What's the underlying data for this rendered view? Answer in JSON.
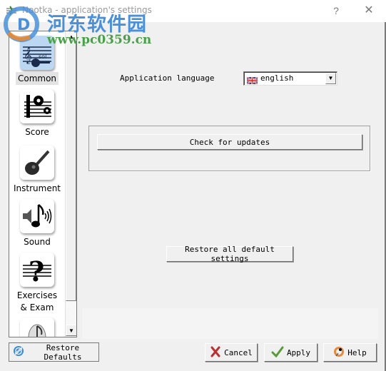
{
  "window": {
    "title": "Nootka - application's settings",
    "help_glyph": "?",
    "close_glyph": "✕"
  },
  "watermark": {
    "site_name": "河东软件园",
    "url": "www.pc0359.cn"
  },
  "sidebar": {
    "items": [
      {
        "label": "Common",
        "icon": "common-settings-icon",
        "active": true
      },
      {
        "label": "Score",
        "icon": "score-settings-icon",
        "active": false
      },
      {
        "label": "Instrument",
        "icon": "guitar-icon",
        "active": false
      },
      {
        "label": "Sound",
        "icon": "sound-icon",
        "active": false
      },
      {
        "label": "Exercises\n& Exam",
        "label_line1": "Exercises",
        "label_line2": "& Exam",
        "icon": "question-staff-icon",
        "active": false
      },
      {
        "label": "",
        "icon": "note-icon",
        "active": false
      }
    ],
    "scroll_up_glyph": "▲",
    "scroll_down_glyph": "▼"
  },
  "common": {
    "language_label": "Application language",
    "language_value": "english",
    "language_flag": "uk-flag-icon",
    "dropdown_glyph": "▼",
    "check_updates_label": "Check for updates",
    "restore_all_label": "Restore all default settings"
  },
  "footer": {
    "restore_defaults_label": "Restore Defaults",
    "cancel_label": "Cancel",
    "apply_label": "Apply",
    "help_label": "Help"
  },
  "colors": {
    "active_nav_bg": "#bcd7f2",
    "watermark_blue": "#4a90d9",
    "watermark_green": "#4aa04a",
    "cancel_red": "#c0392b",
    "apply_green": "#5a9a3a"
  }
}
